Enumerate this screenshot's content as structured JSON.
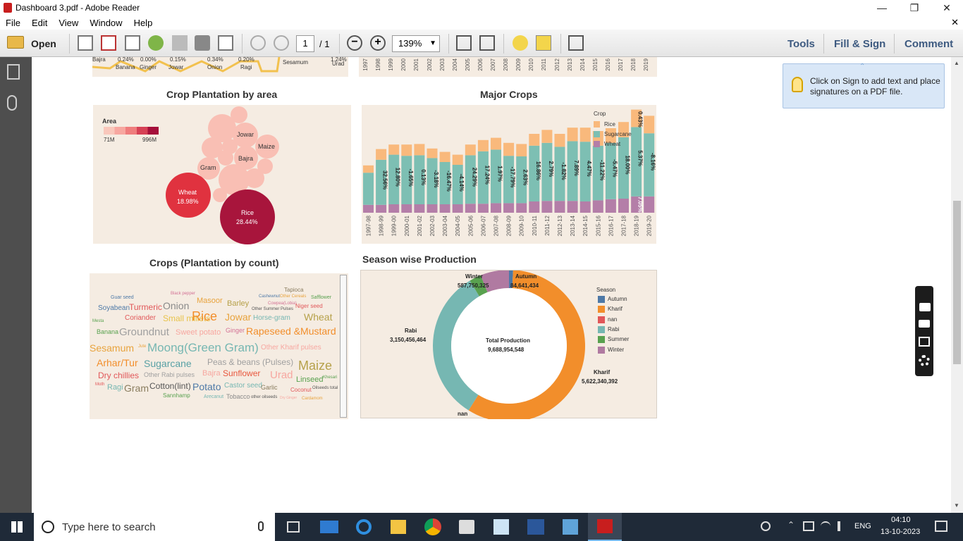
{
  "window": {
    "title": "Dashboard 3.pdf - Adobe Reader"
  },
  "menu": {
    "items": [
      "File",
      "Edit",
      "View",
      "Window",
      "Help"
    ]
  },
  "toolbar": {
    "open_label": "Open",
    "page_current": "1",
    "page_total": "/ 1",
    "zoom": "139%",
    "tools_label": "Tools",
    "fillsign_label": "Fill & Sign",
    "comment_label": "Comment"
  },
  "tip": {
    "text": "Click on Sign to add text and place signatures on a PDF file."
  },
  "top_strip": {
    "labels": [
      {
        "name": "Bajra",
        "val": ""
      },
      {
        "name": "Banana",
        "val": "0.24%"
      },
      {
        "name": "Ginger",
        "val": "0.00%"
      },
      {
        "name": "Jowar",
        "val": "0.15%"
      },
      {
        "name": "Onion",
        "val": "0.34%"
      },
      {
        "name": "Ragi",
        "val": "0.20%"
      },
      {
        "name": "Sesamum",
        "val": ""
      },
      {
        "name": "Urad",
        "val": "1.24%"
      }
    ],
    "years": [
      "1997",
      "1998",
      "1999",
      "2000",
      "2001",
      "2002",
      "2003",
      "2004",
      "2005",
      "2006",
      "2007",
      "2008",
      "2009",
      "2010",
      "2011",
      "2012",
      "2013",
      "2014",
      "2015",
      "2016",
      "2017",
      "2018",
      "2019"
    ]
  },
  "crop_area": {
    "title": "Crop Plantation by area",
    "legend_title": "Area",
    "legend_min": "71M",
    "legend_max": "996M",
    "labels": {
      "wheat": "Wheat",
      "wheat_pct": "18.98%",
      "rice": "Rice",
      "rice_pct": "28.44%",
      "jowar": "Jowar",
      "maize": "Maize",
      "bajra": "Bajra",
      "gram": "Gram"
    }
  },
  "major_crops": {
    "title": "Major Crops",
    "legend_title": "Crop",
    "legend": [
      {
        "name": "Rice",
        "color": "#f9b97c"
      },
      {
        "name": "Sugarcane",
        "color": "#7dbfb3"
      },
      {
        "name": "Wheat",
        "color": "#b47ea8"
      }
    ]
  },
  "chart_data": {
    "type": "bar",
    "title": "Major Crops",
    "stacked": true,
    "categories": [
      "1997-98",
      "1998-99",
      "1999-00",
      "2000-01",
      "2001-02",
      "2002-03",
      "2003-04",
      "2004-05",
      "2005-06",
      "2006-07",
      "2007-08",
      "2008-09",
      "2009-10",
      "2010-11",
      "2011-12",
      "2012-13",
      "2013-14",
      "2014-15",
      "2015-16",
      "2016-17",
      "2017-18",
      "2018-19",
      "2019-20"
    ],
    "series": [
      {
        "name": "Wheat",
        "values": [
          14,
          14,
          15,
          15,
          15,
          15,
          15,
          15,
          16,
          16,
          17,
          17,
          17,
          20,
          21,
          21,
          21,
          20,
          22,
          24,
          25,
          29,
          29
        ]
      },
      {
        "name": "Sugarcane",
        "values": [
          57,
          80,
          88,
          86,
          87,
          82,
          75,
          70,
          86,
          93,
          95,
          84,
          83,
          99,
          103,
          96,
          106,
          106,
          97,
          100,
          109,
          123,
          112
        ]
      },
      {
        "name": "Rice",
        "values": [
          13,
          19,
          18,
          20,
          20,
          17,
          18,
          18,
          19,
          20,
          21,
          23,
          22,
          21,
          23,
          23,
          24,
          25,
          26,
          26,
          27,
          31,
          31
        ]
      }
    ],
    "data_labels": [
      "",
      "32.56%",
      "12.80%",
      "-1.65%",
      "0.13%",
      "-3.18%",
      "-16.47%",
      "-4.14%",
      "24.29%",
      "17.24%",
      "1.97%",
      "-17.79%",
      "2.63%",
      "16.86%",
      "2.79%",
      "-1.82%",
      "7.89%",
      "4.47%",
      "-11.22%",
      "-5.47%",
      "18.00%",
      "5.37%",
      "-8.16%"
    ],
    "extra_labels": [
      "0.43%",
      "7.05%"
    ],
    "ylim": [
      0,
      185
    ]
  },
  "wordcloud": {
    "title": "Crops (Plantation by count)",
    "words": [
      "Tapioca",
      "Guar seed",
      "Black pepper",
      "Cashewnut",
      "Other Cereals",
      "Safflower",
      "Soyabean",
      "Turmeric",
      "Onion",
      "Masoor",
      "Barley",
      "Cowpea(Lobia)",
      "Other Summer Pulses",
      "Niger seed",
      "Mesta",
      "Coriander",
      "Small millets",
      "Rice",
      "Jowar",
      "Horse-gram",
      "Wheat",
      "Banana",
      "Groundnut",
      "Sweet potato",
      "Ginger",
      "Rapeseed &Mustard",
      "Sesamum",
      "Jute",
      "Moong(Green Gram)",
      "Other Kharif pulses",
      "Arhar/Tur",
      "Sugarcane",
      "Peas & beans (Pulses)",
      "Maize",
      "Dry chillies",
      "Other Rabi pulses",
      "Bajra",
      "Sunflower",
      "Urad",
      "Khesari",
      "Moth",
      "Linseed",
      "Ragi",
      "Gram",
      "Cotton(lint)",
      "Potato",
      "Castor seed",
      "Garlic",
      "Coconut",
      "Oilseeds total",
      "Sannhamp",
      "Arecanut",
      "Tobacco",
      "other oilseeds",
      "Dry Ginger",
      "Cardamom"
    ]
  },
  "season": {
    "title": "Season wise Production",
    "center_label": "Total Production",
    "center_value": "9,688,954,548",
    "legend_title": "Season",
    "legend": [
      {
        "name": "Autumn",
        "color": "#4e79a7"
      },
      {
        "name": "Kharif",
        "color": "#f28e2b"
      },
      {
        "name": "nan",
        "color": "#e15759"
      },
      {
        "name": "Rabi",
        "color": "#76b7b2"
      },
      {
        "name": "Summer",
        "color": "#59a14f"
      },
      {
        "name": "Winter",
        "color": "#b07aa1"
      }
    ],
    "slices": [
      {
        "name": "Autumn",
        "value": "84,641,434",
        "num": 84641434
      },
      {
        "name": "Kharif",
        "value": "5,622,340,392",
        "num": 5622340392
      },
      {
        "name": "nan",
        "value": "",
        "num": 1
      },
      {
        "name": "Rabi",
        "value": "3,150,456,464",
        "num": 3150456464
      },
      {
        "name": "Summer",
        "value": "",
        "num": 243766000
      },
      {
        "name": "Winter",
        "value": "587,750,325",
        "num": 587750325
      }
    ]
  },
  "taskbar": {
    "search_placeholder": "Type here to search",
    "time": "04:10",
    "date": "13-10-2023",
    "lang": "ENG"
  }
}
